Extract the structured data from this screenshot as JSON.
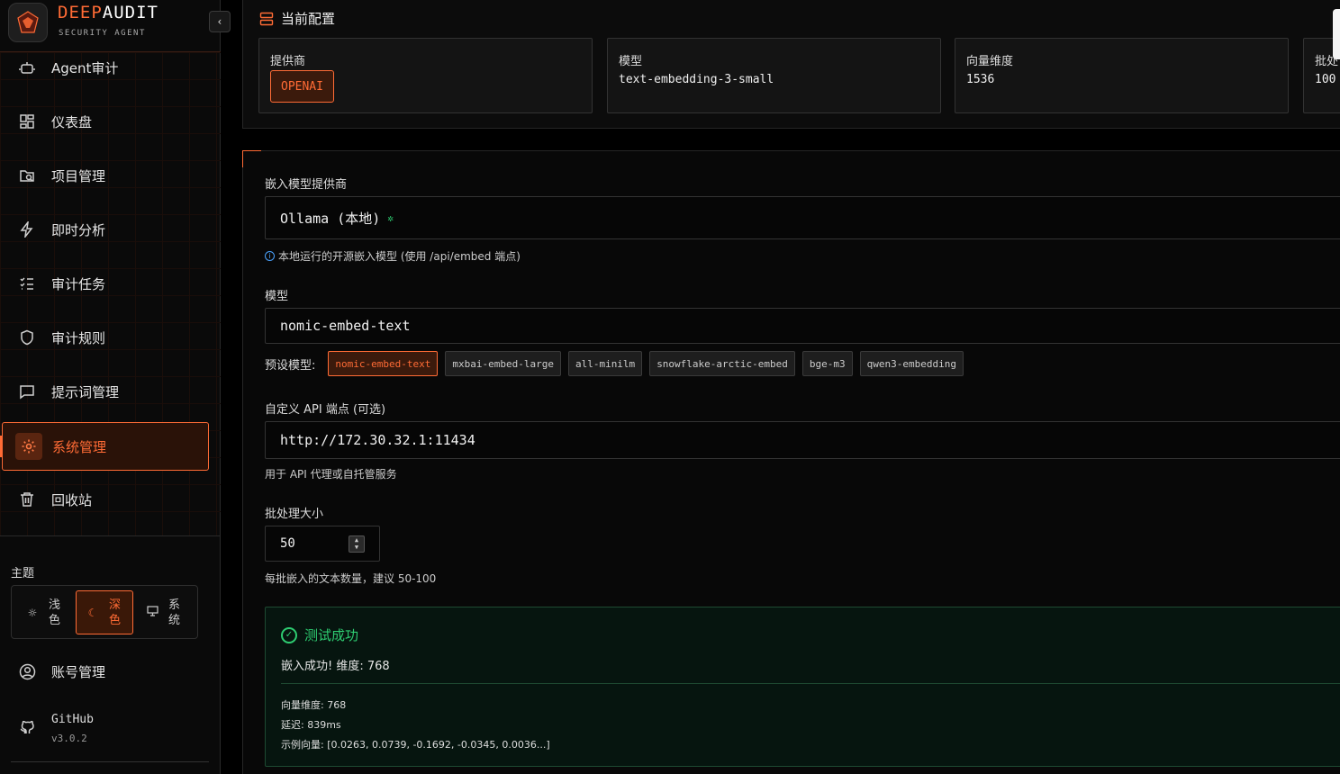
{
  "brand": {
    "name_accent": "DEEP",
    "name_rest": "AUDIT",
    "subtitle": "SECURITY AGENT"
  },
  "sidebar": {
    "collapse_glyph": "‹",
    "items": [
      {
        "label": "Agent审计",
        "icon": "bot-icon"
      },
      {
        "label": "仪表盘",
        "icon": "dashboard-icon"
      },
      {
        "label": "项目管理",
        "icon": "folder-icon"
      },
      {
        "label": "即时分析",
        "icon": "lightning-icon"
      },
      {
        "label": "审计任务",
        "icon": "task-list-icon"
      },
      {
        "label": "审计规则",
        "icon": "shield-icon"
      },
      {
        "label": "提示词管理",
        "icon": "chat-icon"
      },
      {
        "label": "系统管理",
        "icon": "gear-icon",
        "active": true
      },
      {
        "label": "回收站",
        "icon": "trash-icon"
      }
    ],
    "theme": {
      "title": "主题",
      "options": [
        {
          "label": "浅色",
          "icon": "sun-icon"
        },
        {
          "label": "深色",
          "icon": "moon-icon",
          "active": true
        },
        {
          "label": "系统",
          "icon": "monitor-icon"
        }
      ]
    },
    "account": {
      "label": "账号管理"
    },
    "github": {
      "label": "GitHub",
      "version": "v3.0.2"
    }
  },
  "config": {
    "title": "当前配置",
    "cards": [
      {
        "label": "提供商",
        "value": "OPENAI"
      },
      {
        "label": "模型",
        "value": "text-embedding-3-small"
      },
      {
        "label": "向量维度",
        "value": "1536"
      },
      {
        "label": "批处",
        "value": "100"
      }
    ]
  },
  "form": {
    "provider": {
      "label": "嵌入模型提供商",
      "value": "Ollama (本地)",
      "hint": "本地运行的开源嵌入模型 (使用 /api/embed 端点)"
    },
    "model": {
      "label": "模型",
      "value": "nomic-embed-text",
      "presets_label": "预设模型:",
      "presets": [
        "nomic-embed-text",
        "mxbai-embed-large",
        "all-minilm",
        "snowflake-arctic-embed",
        "bge-m3",
        "qwen3-embedding"
      ]
    },
    "endpoint": {
      "label": "自定义 API 端点 (可选)",
      "value": "http://172.30.32.1:11434",
      "hint": "用于 API 代理或自托管服务"
    },
    "batch": {
      "label": "批处理大小",
      "value": "50",
      "hint": "每批嵌入的文本数量，建议 50-100"
    }
  },
  "result": {
    "title": "测试成功",
    "message": "嵌入成功! 维度: 768",
    "dimension": "向量维度: 768",
    "latency": "延迟: 839ms",
    "sample": "示例向量: [0.0263, 0.0739, -0.1692, -0.0345, 0.0036...]"
  },
  "colors": {
    "accent": "#ff6b35",
    "success": "#2ecc71",
    "info": "#4aa3ff"
  }
}
